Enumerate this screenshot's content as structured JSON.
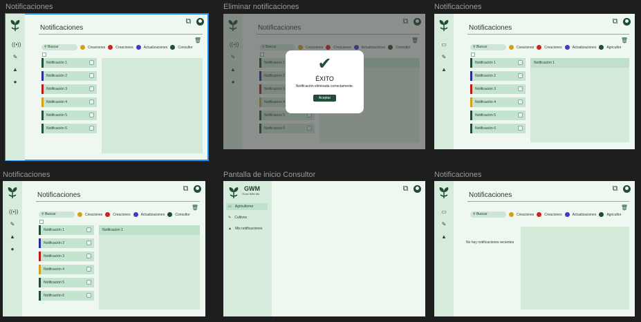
{
  "frames": [
    {
      "title": "Notificaciones"
    },
    {
      "title": "Eliminar notificaciones"
    },
    {
      "title": "Notificaciones"
    },
    {
      "title": "Notificaciones"
    },
    {
      "title": "Pantalla de inicio Consultor"
    },
    {
      "title": "Notificaciones"
    }
  ],
  "page": {
    "title": "Notificaciones",
    "search_placeholder": "Buscar",
    "legend": [
      {
        "label": "Creaciones",
        "color": "#d4a017"
      },
      {
        "label": "Creaciones",
        "color": "#d42020"
      },
      {
        "label": "Actualizaciones",
        "color": "#3b3bc8"
      },
      {
        "label": "Consultor",
        "color": "#1f4d36"
      }
    ],
    "legend_alt_last": "Agricultor",
    "notifications": [
      {
        "label": "Notificación 1",
        "color": "#1f4d36"
      },
      {
        "label": "Notificación 2",
        "color": "#2a2aa0"
      },
      {
        "label": "Notificación 3",
        "color": "#c01818"
      },
      {
        "label": "Notificación 4",
        "color": "#d4a017"
      },
      {
        "label": "Notificación 5",
        "color": "#1f4d36"
      },
      {
        "label": "Notificación 6",
        "color": "#1f4d36"
      }
    ],
    "detail_header": "Notificación 1",
    "empty_message": "No hay notificaciones recientes"
  },
  "modal": {
    "title": "ÉXITO",
    "message": "Notificación eliminada correctamente.",
    "button": "Aceptar"
  },
  "gwm": {
    "logo": "GWM",
    "tagline": "Grow With Me",
    "nav": [
      "Agricultores",
      "Cultivos",
      "Mis notificaciones"
    ]
  }
}
